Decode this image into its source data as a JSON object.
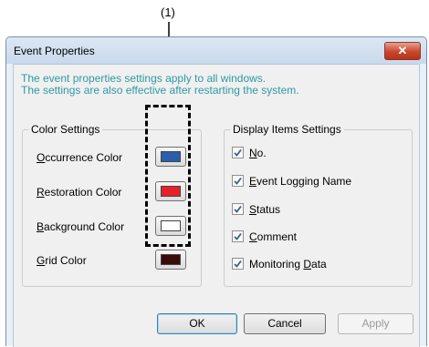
{
  "annotation": {
    "label": "(1)"
  },
  "window": {
    "title": "Event Properties",
    "close_glyph": "✕",
    "info_lines": [
      "The event properties settings apply to all windows.",
      "The settings are also effective after restarting the system."
    ]
  },
  "color_settings": {
    "title": "Color Settings",
    "items": [
      {
        "mnemonic": "O",
        "rest": "ccurrence Color",
        "color": "#2a5fae"
      },
      {
        "mnemonic": "R",
        "rest": "estoration Color",
        "color": "#e8202a"
      },
      {
        "mnemonic": "B",
        "rest": "ackground Color",
        "color": "#ffffff"
      },
      {
        "mnemonic": "G",
        "rest": "rid Color",
        "color": "#3b0a0a"
      }
    ]
  },
  "display_items": {
    "title": "Display Items Settings",
    "items": [
      {
        "pre": "",
        "mnemonic": "N",
        "rest": "o.",
        "checked": true
      },
      {
        "pre": "",
        "mnemonic": "E",
        "rest": "vent Logging Name",
        "checked": true
      },
      {
        "pre": "",
        "mnemonic": "S",
        "rest": "tatus",
        "checked": true
      },
      {
        "pre": "",
        "mnemonic": "C",
        "rest": "omment",
        "checked": true
      },
      {
        "pre": "Monitoring ",
        "mnemonic": "D",
        "rest": "ata",
        "checked": true
      }
    ]
  },
  "buttons": {
    "ok": "OK",
    "cancel": "Cancel",
    "apply": "Apply"
  }
}
